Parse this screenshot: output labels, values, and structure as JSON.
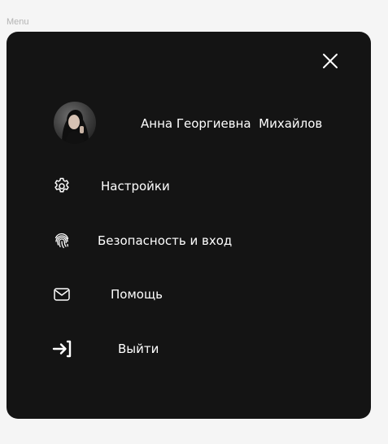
{
  "frame": {
    "label": "Menu"
  },
  "menu": {
    "user": {
      "name": "Анна Георгиевна  Михайлов"
    },
    "items": [
      {
        "id": "settings",
        "label": "Настройки",
        "icon": "gear-icon"
      },
      {
        "id": "security",
        "label": "Безопасность и вход",
        "icon": "fingerprint-icon"
      },
      {
        "id": "help",
        "label": "Помощь",
        "icon": "mail-icon"
      },
      {
        "id": "logout",
        "label": "Выйти",
        "icon": "logout-icon"
      }
    ]
  },
  "colors": {
    "panel_background": "#141414",
    "page_background": "#f5f5f5",
    "text": "#ffffff"
  }
}
